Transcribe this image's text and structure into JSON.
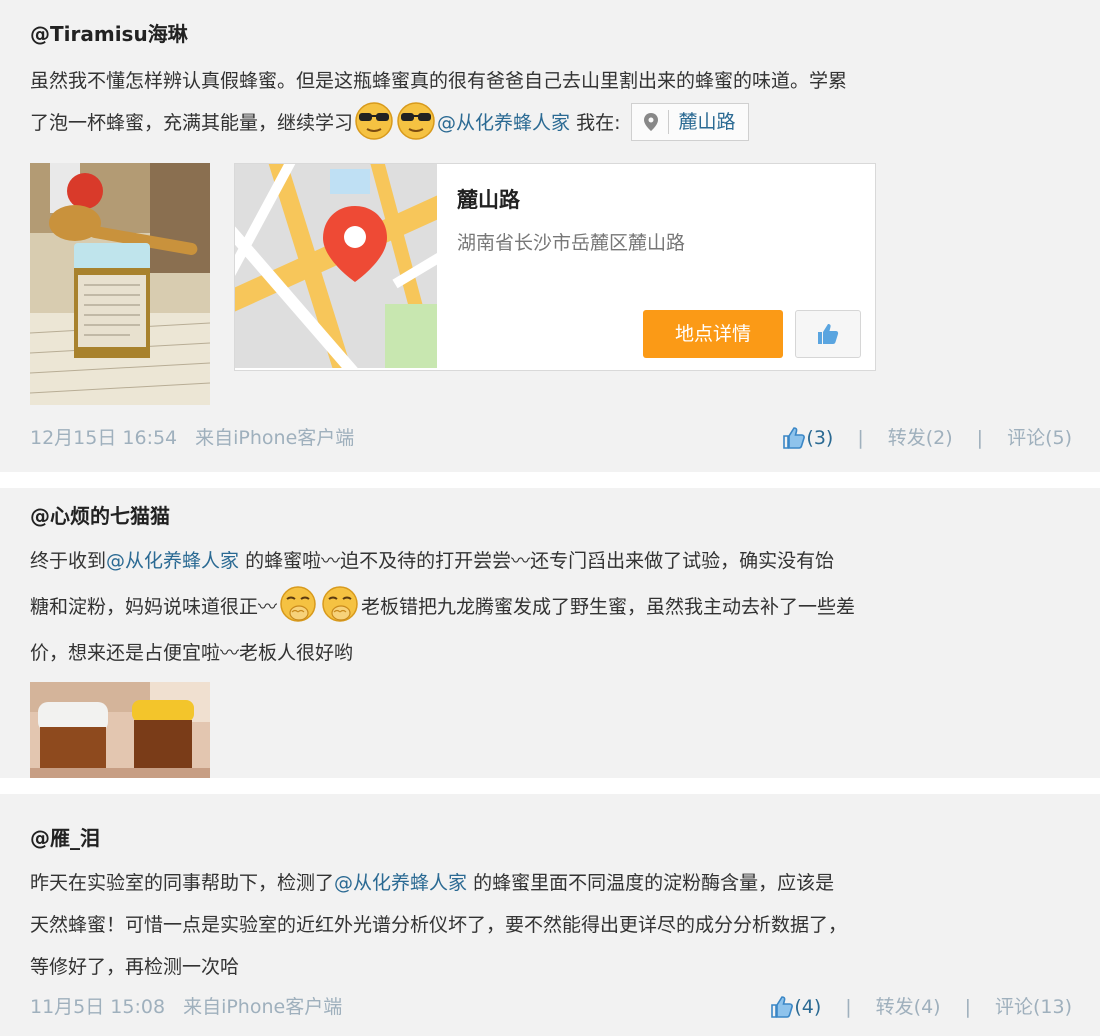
{
  "posts": [
    {
      "author": "@Tiramisu海琳",
      "line1": "虽然我不懂怎样辨认真假蜂蜜。但是这瓶蜂蜜真的很有爸爸自己去山里割出来的蜂蜜的味道。学累",
      "line2_pre": "了泡一杯蜂蜜，充满其能量，继续学习",
      "mention": "@从化养蜂人家",
      "location_prefix": "我在:",
      "location_chip": "麓山路",
      "map": {
        "title": "麓山路",
        "address": "湖南省长沙市岳麓区麓山路",
        "detail_button": "地点详情"
      },
      "time": "12月15日 16:54",
      "source": "来自iPhone客户端",
      "likes": "(3)",
      "repost": "转发(2)",
      "comment": "评论(5)"
    },
    {
      "author": "@心烦的七猫猫",
      "line1_pre": "终于收到",
      "mention": "@从化养蜂人家",
      "line1_post": " 的蜂蜜啦〰迫不及待的打开尝尝〰还专门舀出来做了试验，确实没有饴",
      "line2_pre": "糖和淀粉，妈妈说味道很正〰",
      "line2_post": "老板错把九龙腾蜜发成了野生蜜，虽然我主动去补了一些差",
      "line3": "价，想来还是占便宜啦〰老板人很好哟"
    },
    {
      "author": "@雁_泪",
      "line1_pre": "昨天在实验室的同事帮助下，检测了",
      "mention": "@从化养蜂人家",
      "line1_post": " 的蜂蜜里面不同温度的淀粉酶含量，应该是",
      "line2": "天然蜂蜜！可惜一点是实验室的近红外光谱分析仪坏了，要不然能得出更详尽的成分分析数据了，",
      "line3": "等修好了，再检测一次哈",
      "time": "11月5日 15:08",
      "source": "来自iPhone客户端",
      "likes": "(4)",
      "repost": "转发(4)",
      "comment": "评论(13)"
    }
  ],
  "colors": {
    "background": "#f2f2f2",
    "mention": "#2b6a93",
    "muted": "#9fb0bd",
    "accent_button": "#fb9a16",
    "map_pin": "#ee4a35"
  },
  "icons": [
    "sunglasses-emoji",
    "giggle-emoji",
    "location-pin-icon",
    "thumbs-up-icon"
  ]
}
